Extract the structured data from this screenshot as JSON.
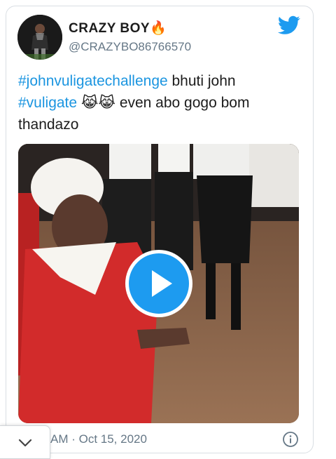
{
  "tweet": {
    "author": {
      "display_name": "CRAZY BOY",
      "name_emoji": "🔥",
      "handle": "@CRAZYBO86766570"
    },
    "text": {
      "hashtag1": "#johnvuligatechallenge",
      "part1": " bhuti john ",
      "hashtag2": "#vuligate",
      "emojis": " 😹😹 ",
      "part2": "even abo gogo bom thandazo"
    },
    "media": {
      "type": "video",
      "play_icon": "play-icon"
    },
    "timestamp": "AM · Oct 15, 2020"
  },
  "icons": {
    "brand": "twitter-bird-icon",
    "info": "info-icon",
    "collapse": "chevron-down-icon"
  },
  "colors": {
    "brand_blue": "#1d9bf0",
    "hashtag_blue": "#1b95e0",
    "secondary_text": "#657786",
    "primary_text": "#1c1c1c"
  }
}
